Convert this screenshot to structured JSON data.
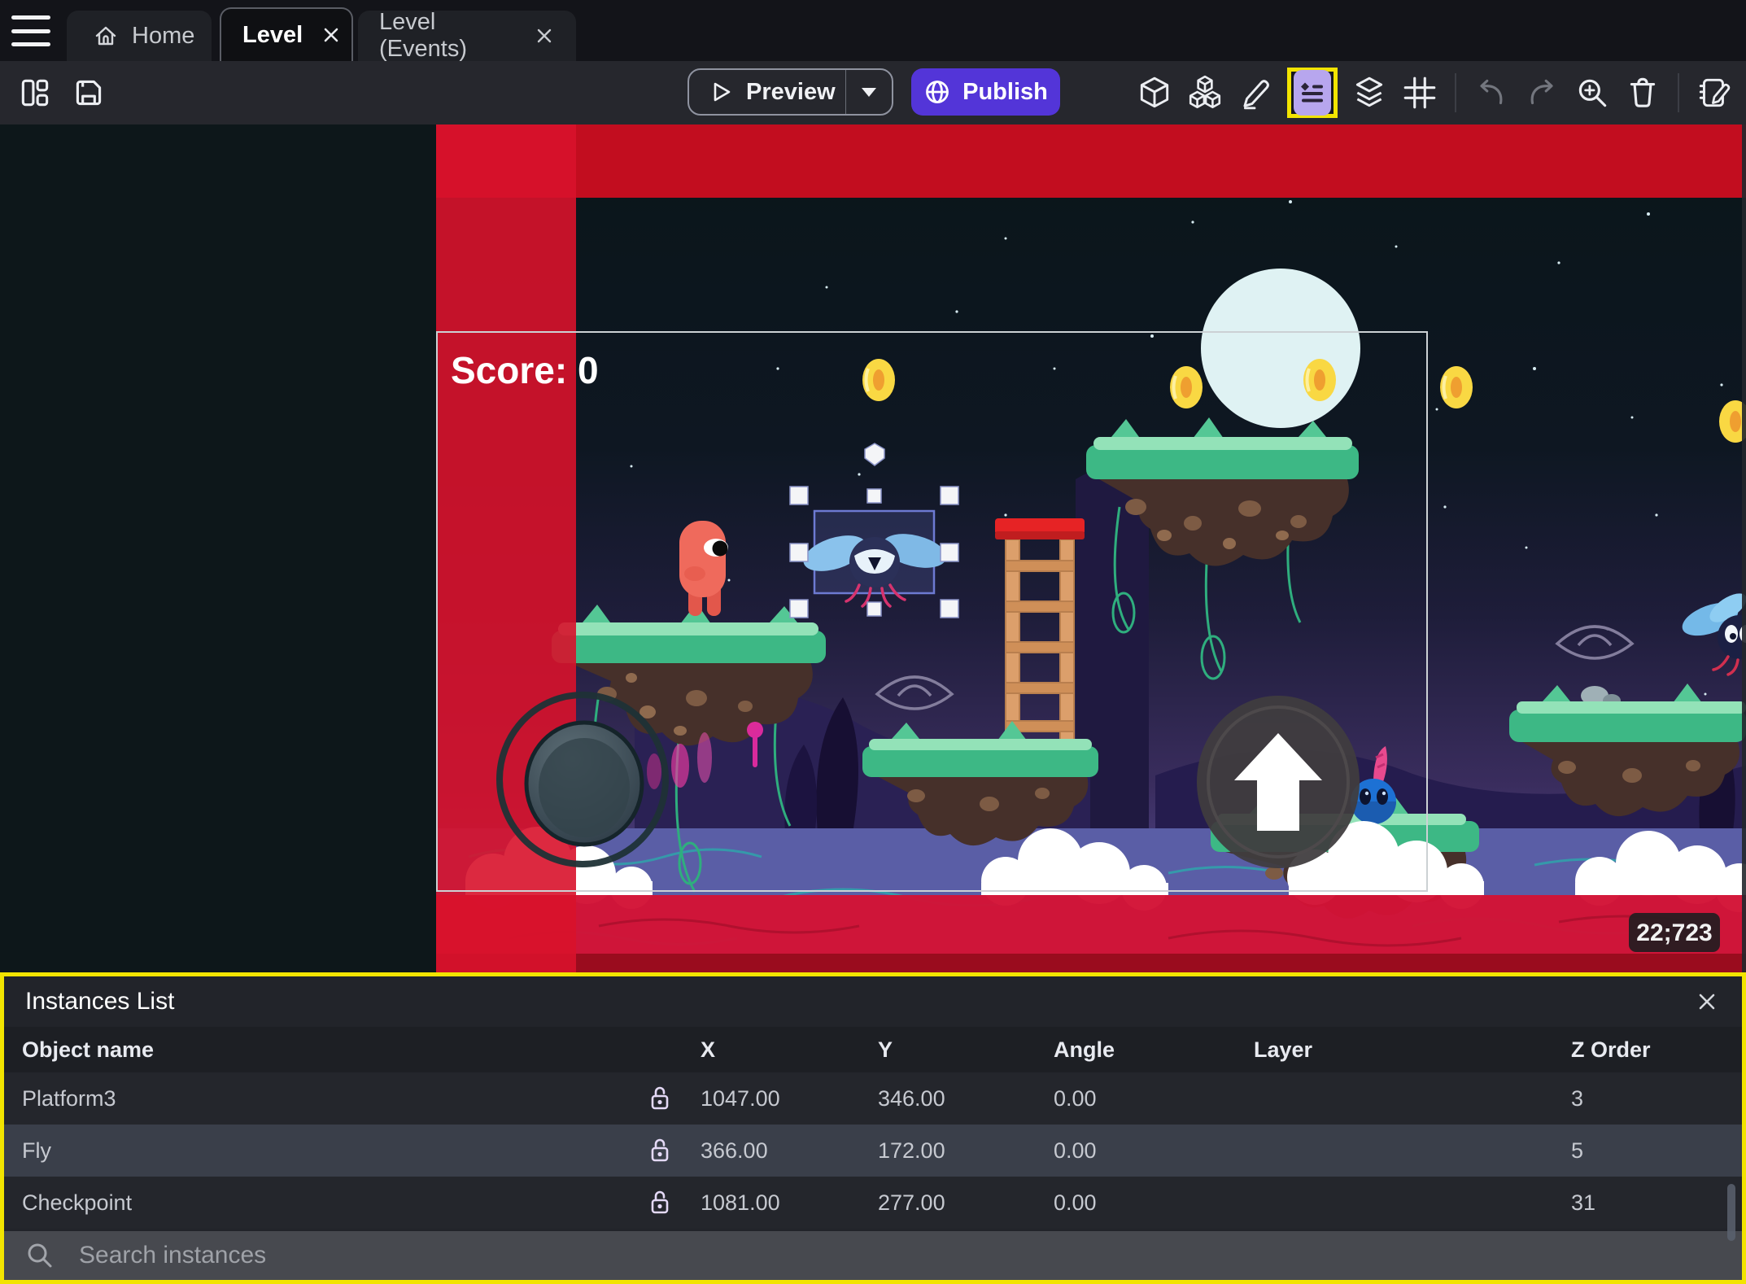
{
  "tabs": {
    "home": "Home",
    "level": "Level",
    "level_events": "Level (Events)"
  },
  "toolbar": {
    "preview_label": "Preview",
    "publish_label": "Publish",
    "left_icons": [
      "layout-panels",
      "save"
    ],
    "right_icons": [
      "cube-3d",
      "objects-cubes",
      "edit-pencil",
      "instances-list",
      "layers",
      "grid",
      "undo",
      "redo",
      "zoom-in",
      "delete",
      "scene-properties"
    ]
  },
  "scene": {
    "score_text": "Score: 0",
    "badge": "22;723",
    "selected_instance": "Fly"
  },
  "instances_panel": {
    "title": "Instances List",
    "columns": [
      "Object name",
      "X",
      "Y",
      "Angle",
      "Layer",
      "Z Order"
    ],
    "rows": [
      {
        "name": "Platform3",
        "x": "1047.00",
        "y": "346.00",
        "angle": "0.00",
        "layer": "",
        "z": "3"
      },
      {
        "name": "Fly",
        "x": "366.00",
        "y": "172.00",
        "angle": "0.00",
        "layer": "",
        "z": "5"
      },
      {
        "name": "Checkpoint",
        "x": "1081.00",
        "y": "277.00",
        "angle": "0.00",
        "layer": "",
        "z": "31"
      }
    ],
    "search_placeholder": "Search instances"
  },
  "colors": {
    "accent-purple": "#5335d8",
    "highlight-yellow": "#f2e400",
    "selection-lavender": "#b7a6ee",
    "row-alt": "#3a3f4a",
    "band-red-top": "#c20d1f",
    "band-red-bottom": "#d31336",
    "selection-blue": "#6d7ad2"
  }
}
